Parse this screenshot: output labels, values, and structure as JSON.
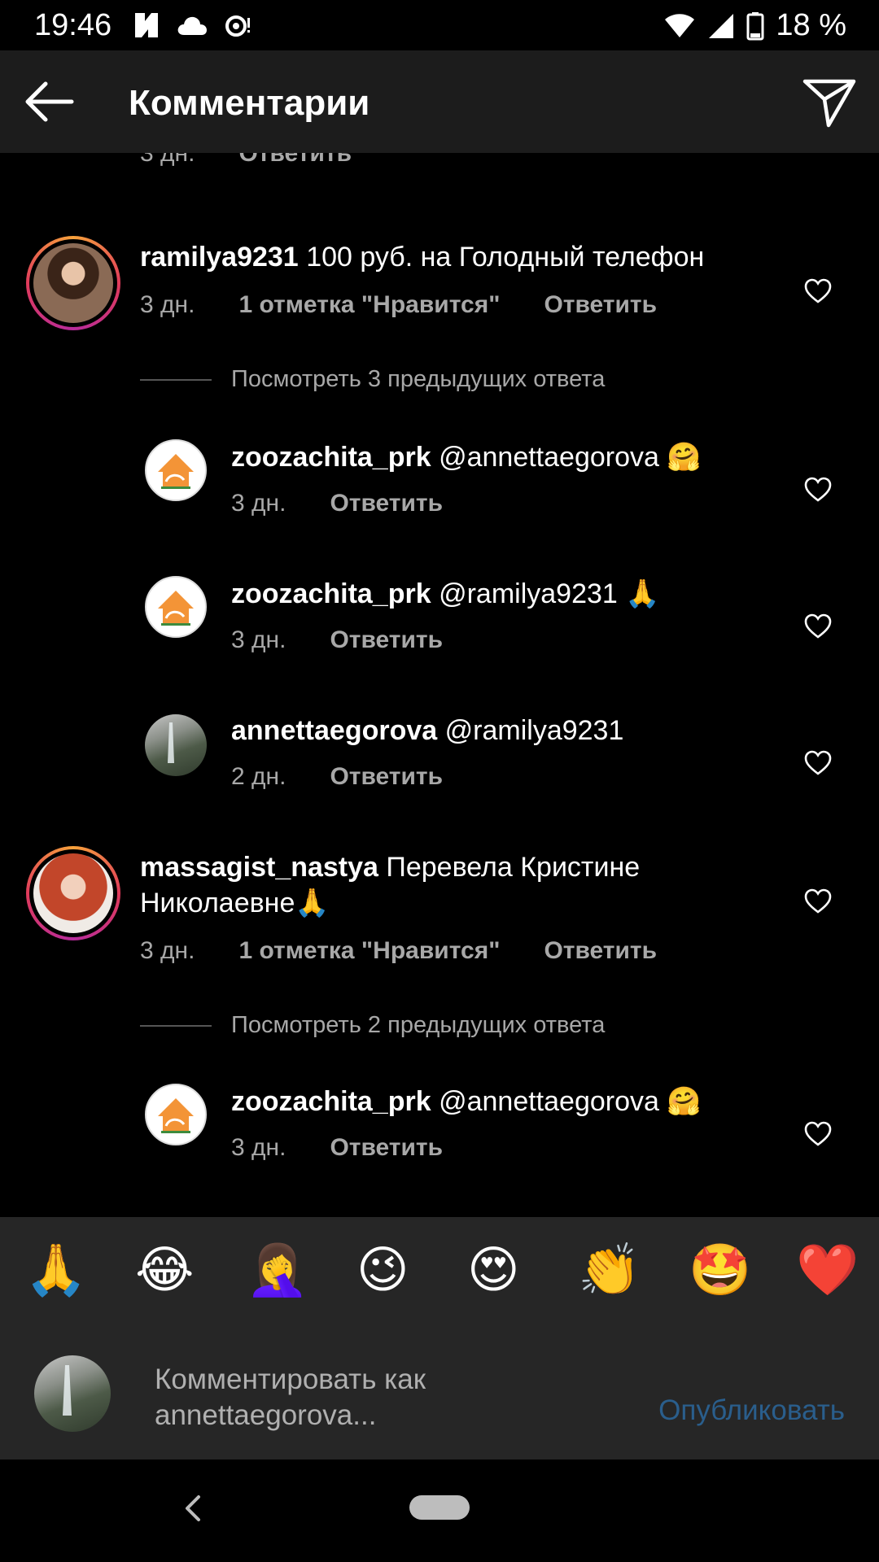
{
  "status_bar": {
    "time": "19:46",
    "battery": "18 %",
    "icons": [
      "app-notification-icon",
      "cloud-icon",
      "sync-icon",
      "wifi-icon",
      "signal-icon",
      "battery-icon"
    ]
  },
  "header": {
    "title": "Комментарии",
    "back_icon": "arrow-left-icon",
    "send_icon": "paper-plane-icon"
  },
  "top_partial": {
    "time": "3 дн.",
    "reply": "Ответить"
  },
  "comments": [
    {
      "username": "ramilya9231",
      "text": "100 руб. на Голодный телефон",
      "time": "3 дн.",
      "likes": "1 отметка \"Нравится\"",
      "reply": "Ответить",
      "view_replies": "Посмотреть 3 предыдущих ответа",
      "replies": [
        {
          "username": "zoozachita_prk",
          "text": "@annettaegorova 🤗",
          "time": "3 дн.",
          "reply": "Ответить"
        },
        {
          "username": "zoozachita_prk",
          "text": "@ramilya9231 🙏",
          "time": "3 дн.",
          "reply": "Ответить"
        },
        {
          "username": "annettaegorova",
          "text": "@ramilya9231",
          "time": "2 дн.",
          "reply": "Ответить"
        }
      ]
    },
    {
      "username": "massagist_nastya",
      "text": "Перевела Кристине Николаевне🙏",
      "time": "3 дн.",
      "likes": "1 отметка \"Нравится\"",
      "reply": "Ответить",
      "view_replies": "Посмотреть 2 предыдущих ответа",
      "replies": [
        {
          "username": "zoozachita_prk",
          "text": "@annettaegorova 🤗",
          "time": "3 дн.",
          "reply": "Ответить"
        }
      ]
    }
  ],
  "emoji_bar": [
    "🙏",
    "😂",
    "🤦‍♀️",
    "😉",
    "😍",
    "👏",
    "🤩",
    "❤️"
  ],
  "comment_input": {
    "placeholder": "Комментировать как annettaegorova...",
    "publish": "Опубликовать"
  },
  "colors": {
    "background": "#000000",
    "header_bg": "#1c1c1c",
    "muted_text": "#a8a8a8",
    "publish_disabled": "#2a5e8c",
    "story_ring_start": "#f7a23b",
    "story_ring_end": "#b72b9c"
  }
}
